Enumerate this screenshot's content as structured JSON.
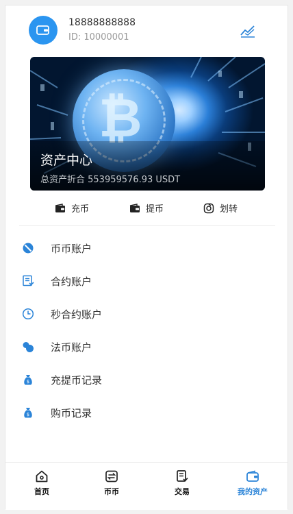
{
  "user": {
    "phone": "18888888888",
    "id_text": "ID: 10000001"
  },
  "banner": {
    "title": "资产中心",
    "subtitle": "总资产折合 553959576.93 USDT"
  },
  "actions": [
    {
      "label": "充币",
      "icon": "wallet-in-icon"
    },
    {
      "label": "提币",
      "icon": "wallet-out-icon"
    },
    {
      "label": "划转",
      "icon": "transfer-icon"
    }
  ],
  "menu": [
    {
      "label": "币币账户",
      "icon": "coin-slash-icon"
    },
    {
      "label": "合约账户",
      "icon": "contract-doc-icon"
    },
    {
      "label": "秒合约账户",
      "icon": "clock-icon"
    },
    {
      "label": "法币账户",
      "icon": "two-circles-icon"
    },
    {
      "label": "充提币记录",
      "icon": "money-bag-icon"
    },
    {
      "label": "购币记录",
      "icon": "money-bag-icon"
    }
  ],
  "tabs": [
    {
      "label": "首页",
      "icon": "home-icon"
    },
    {
      "label": "币币",
      "icon": "exchange-icon"
    },
    {
      "label": "交易",
      "icon": "trade-doc-icon"
    },
    {
      "label": "我的资产",
      "icon": "wallet-icon",
      "active": true
    }
  ],
  "colors": {
    "accent": "#2b95f0",
    "tab_active": "#2b84d8"
  }
}
